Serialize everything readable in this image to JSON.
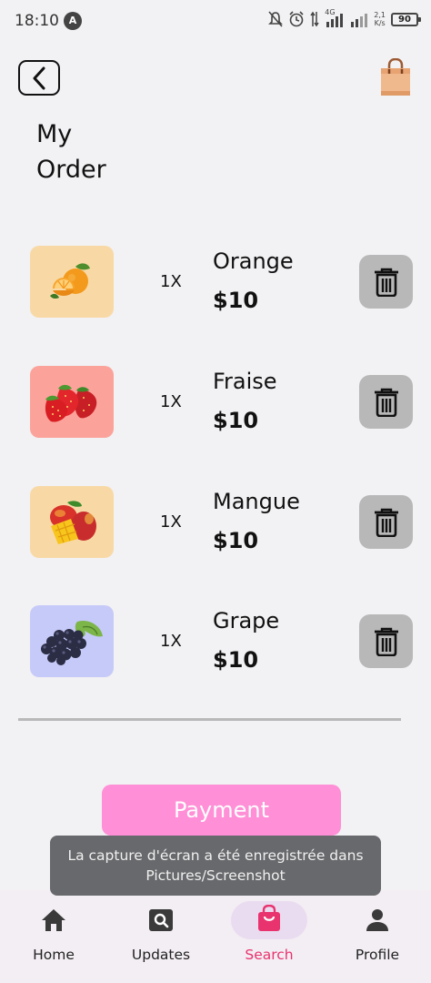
{
  "status_bar": {
    "time": "18:10",
    "notification_letter": "A",
    "net_speed_value": "2,1",
    "net_speed_unit": "K/s",
    "network": "4G",
    "battery": "90"
  },
  "header": {
    "title": "My\nOrder"
  },
  "order_items": [
    {
      "quantity": "1X",
      "name": "Orange",
      "price": "$10",
      "image": "orange-icon",
      "bg": "#f8d9a6"
    },
    {
      "quantity": "1X",
      "name": "Fraise",
      "price": "$10",
      "image": "strawberry-icon",
      "bg": "#fba29a"
    },
    {
      "quantity": "1X",
      "name": "Mangue",
      "price": "$10",
      "image": "mango-icon",
      "bg": "#f8d9a6"
    },
    {
      "quantity": "1X",
      "name": "Grape",
      "price": "$10",
      "image": "grape-icon",
      "bg": "#c6caf8"
    }
  ],
  "payment": {
    "label": "Payment",
    "color": "#ff8fd6"
  },
  "toast": {
    "message": "La capture d'écran a été enregistrée dans  Pictures/Screenshot"
  },
  "bottom_nav": {
    "items": [
      {
        "label": "Home",
        "icon": "home-icon"
      },
      {
        "label": "Updates",
        "icon": "search-box-icon"
      },
      {
        "label": "Search",
        "icon": "shopping-bag-icon",
        "active": true
      },
      {
        "label": "Profile",
        "icon": "person-icon"
      }
    ],
    "active_color": "#e8336e"
  }
}
